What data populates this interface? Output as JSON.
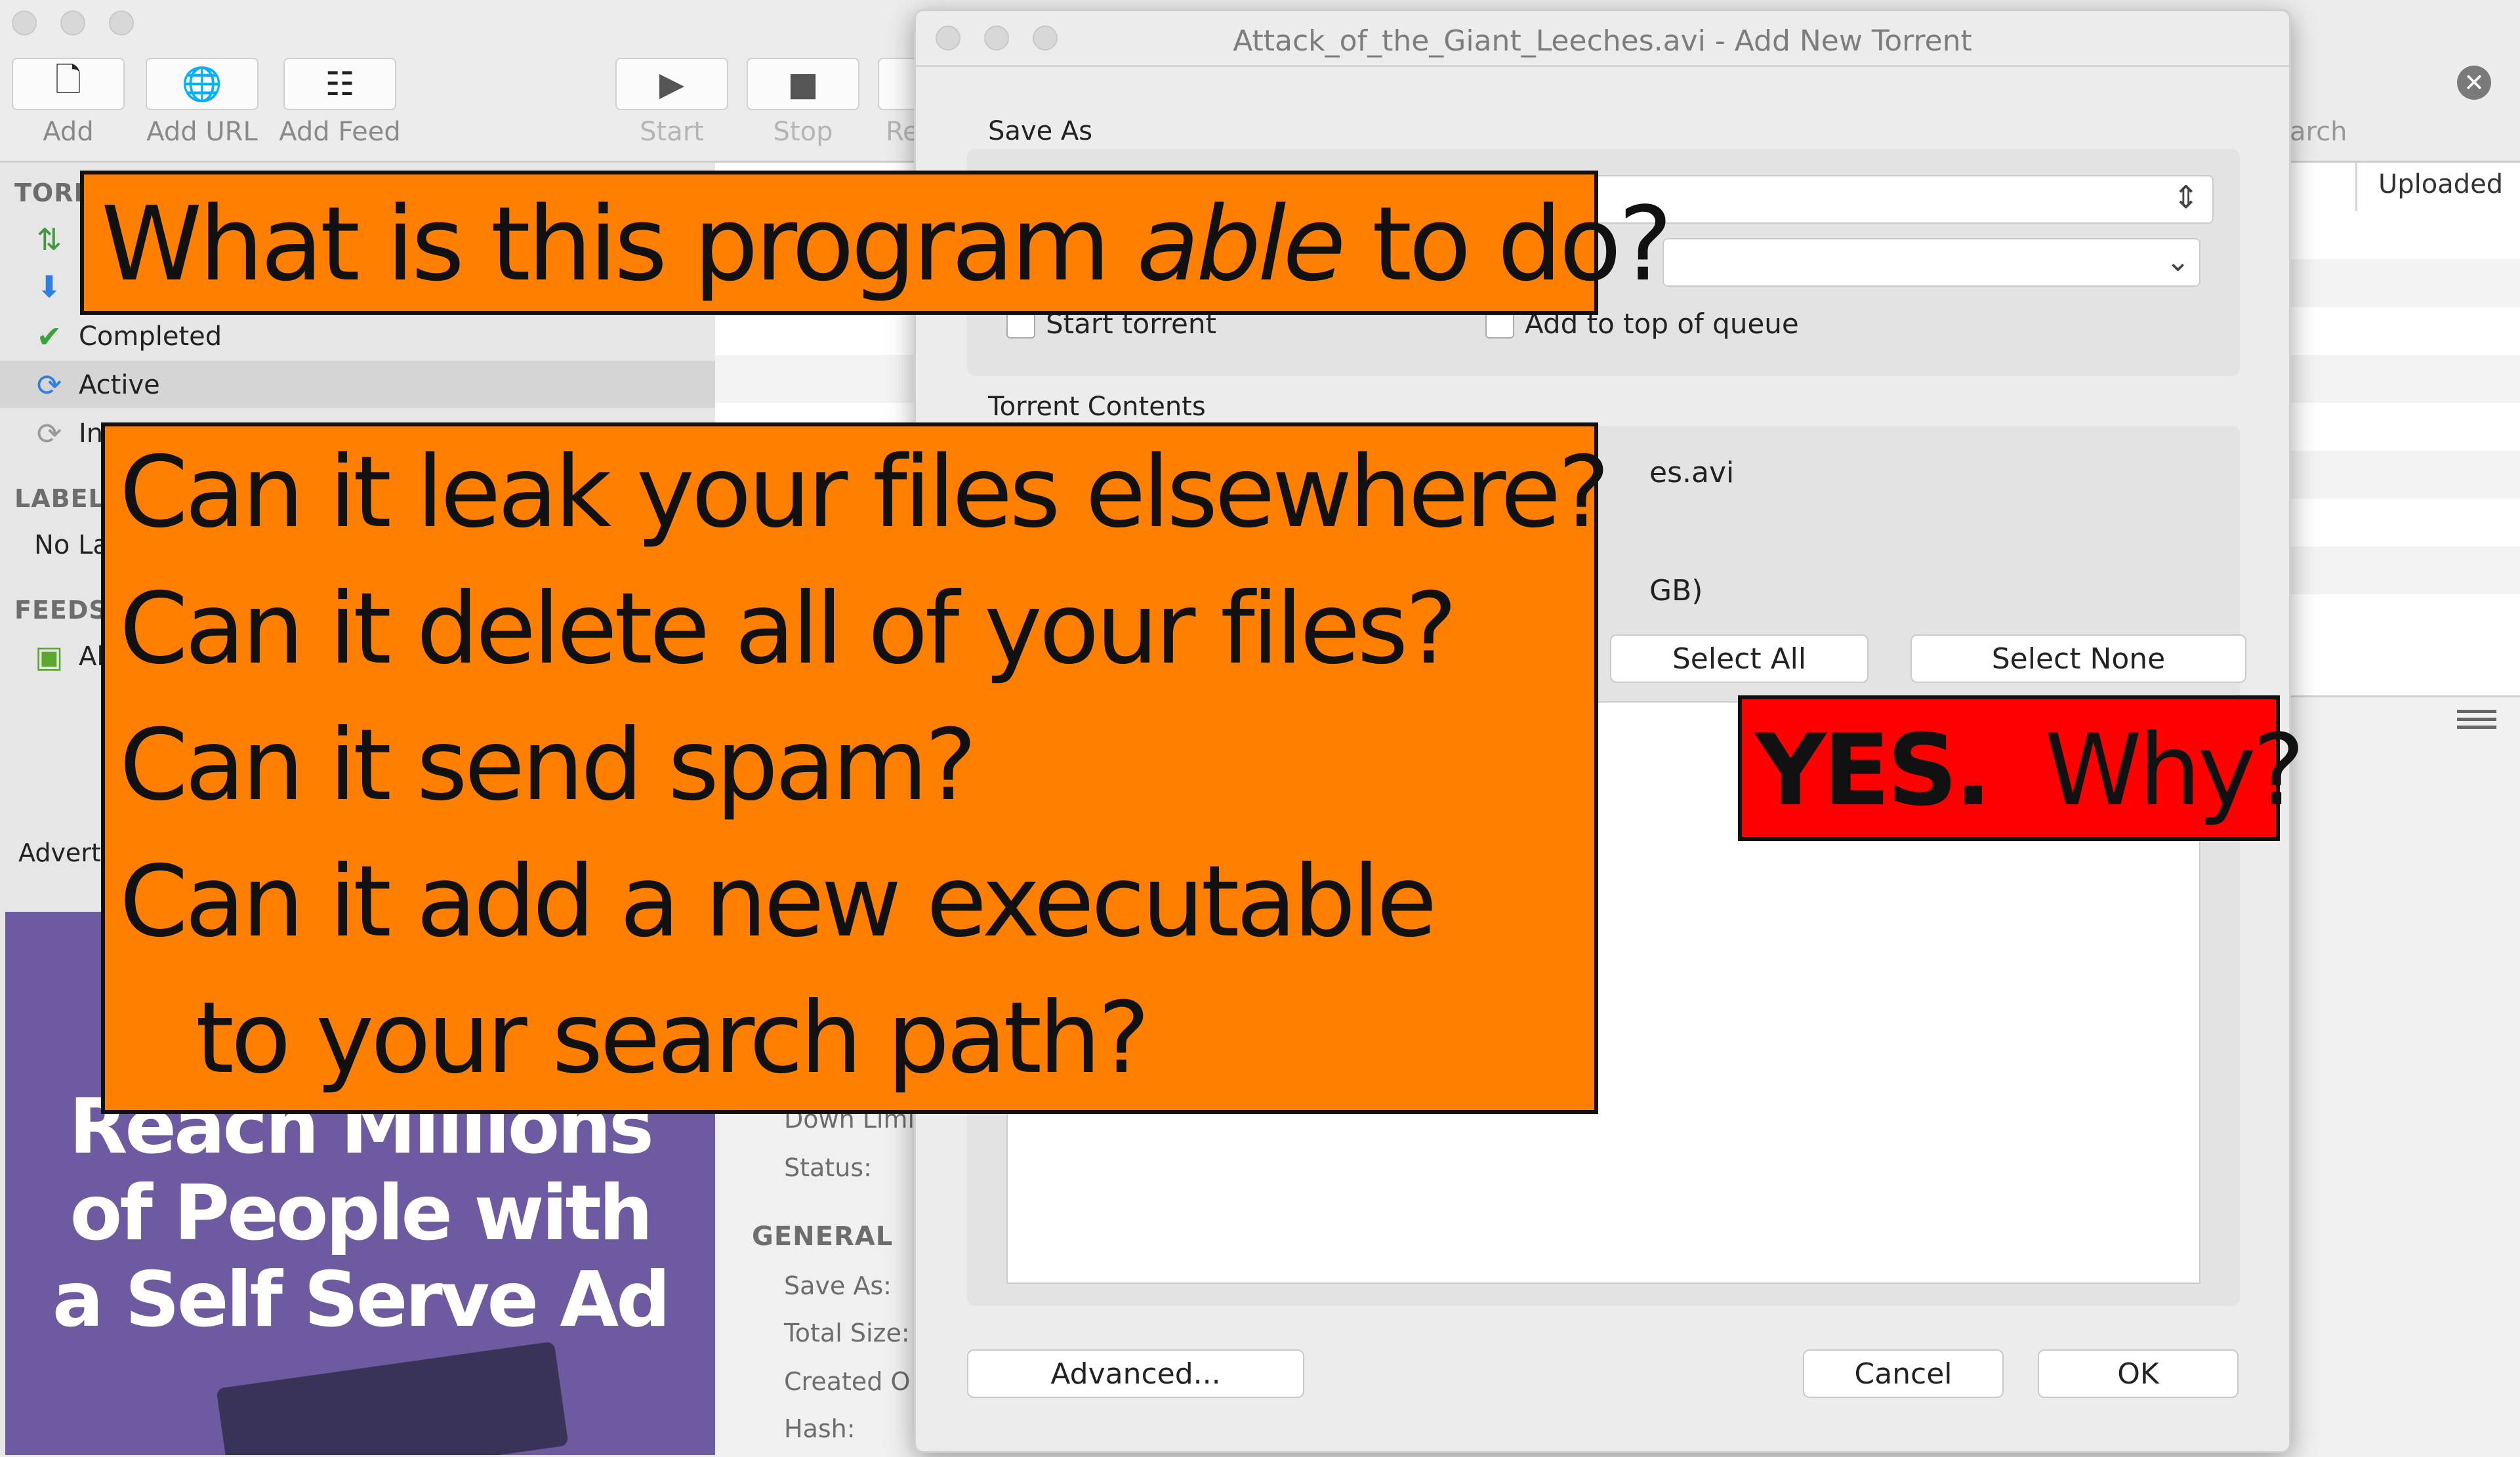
{
  "toolbar": {
    "add_label": "Add",
    "add_url_label": "Add URL",
    "add_feed_label": "Add Feed",
    "start_label": "Start",
    "stop_label": "Stop",
    "re_label": "Re",
    "search_partial": "arch"
  },
  "sidebar": {
    "torrents_head": "TORR",
    "completed": "Completed",
    "active": "Active",
    "inactive_partial": "In",
    "labels_head": "LABEL",
    "no_labels": "No La",
    "feeds_head": "FEEDS",
    "feed_item": "Al",
    "advert": "Advert"
  },
  "ad": {
    "line1": "Reach Millions",
    "line2": "of People with",
    "line3": "a Self Serve Ad"
  },
  "list": {
    "uploaded_header": "Uploaded"
  },
  "details": {
    "down_limit": "Down Limi",
    "status": "Status:",
    "general_head": "GENERAL",
    "save_as": "Save As:",
    "total_size": "Total Size:",
    "created_on": "Created O",
    "hash": "Hash:"
  },
  "dialog": {
    "title": "Attack_of_the_Giant_Leeches.avi - Add New Torrent",
    "save_as_label": "Save As",
    "start_torrent": "Start torrent",
    "add_to_top": "Add to top of queue",
    "contents_label": "Torrent Contents",
    "file_name_partial": "es.avi",
    "size_partial": "GB)",
    "select_all": "Select All",
    "select_none": "Select None",
    "advanced": "Advanced...",
    "cancel": "Cancel",
    "ok": "OK"
  },
  "overlay": {
    "title_pre": "What is this program ",
    "title_em": "able",
    "title_post": " to do?",
    "q1": "Can it leak your files elsewhere?",
    "q2": "Can it delete all of your files?",
    "q3": "Can it send spam?",
    "q4": "Can it add a new executable",
    "q5": "to your search path?",
    "answer_bold": "YES.",
    "answer_rest": "  Why?"
  },
  "colors": {
    "overlay_orange": "#ff7f00",
    "overlay_red": "#ff0000",
    "ad_purple": "#6e5aa1"
  }
}
